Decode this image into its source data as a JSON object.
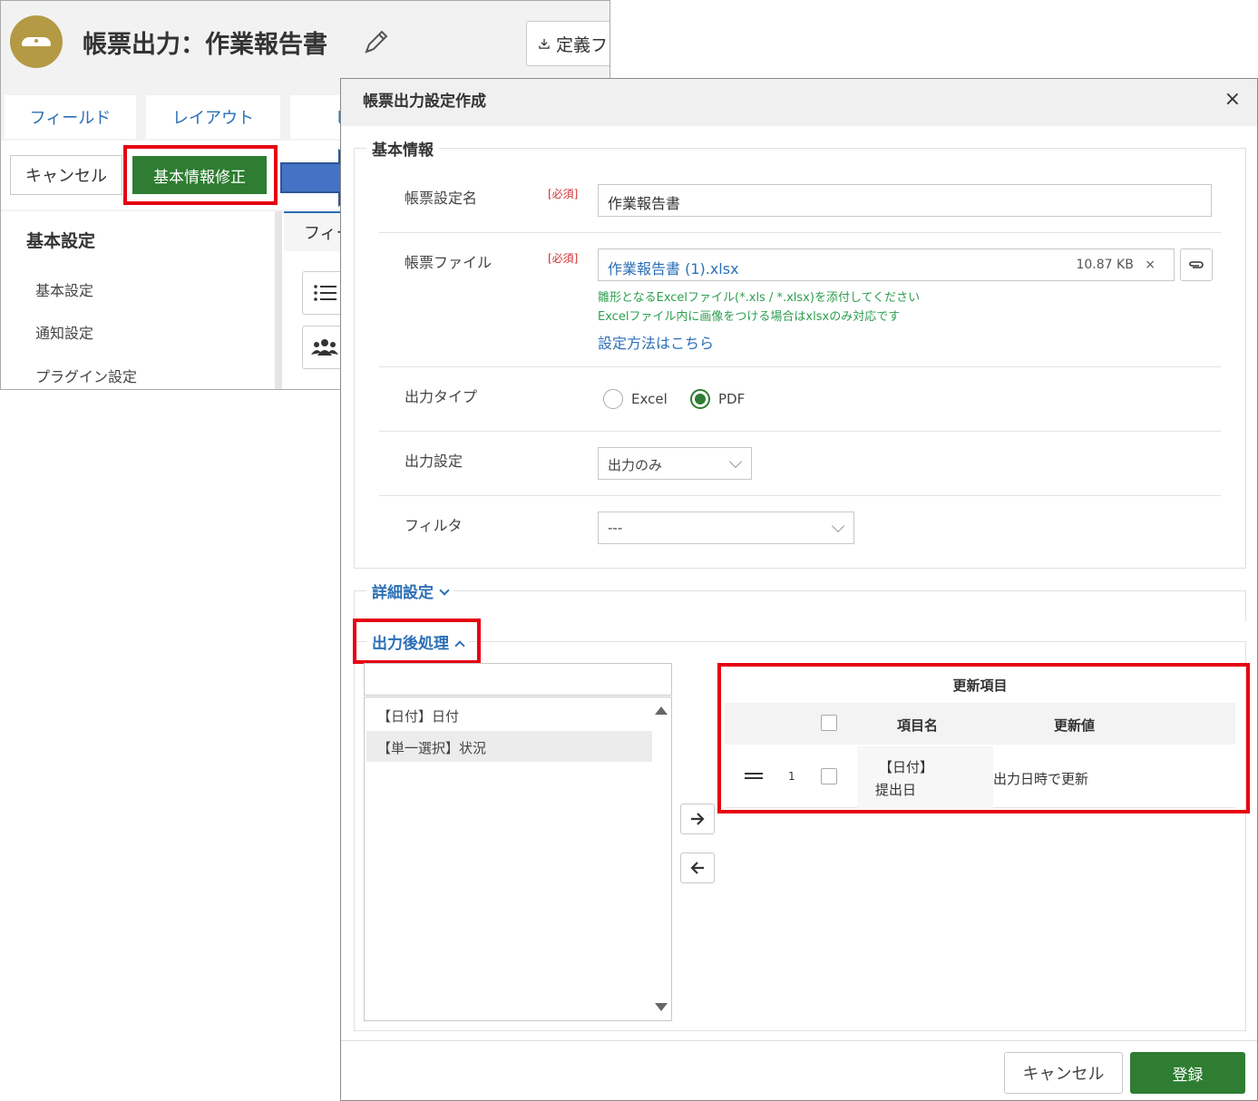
{
  "app": {
    "title": "帳票出力：作業報告書",
    "define_button": "定義ファ",
    "tabs": [
      "フィールド",
      "レイアウト",
      "ビ"
    ],
    "cancel": "キャンセル",
    "edit_basic": "基本情報修正",
    "side_menu": {
      "title": "基本設定",
      "items": [
        "基本設定",
        "通知設定",
        "プラグイン設定"
      ]
    },
    "pane_tab": "フィー"
  },
  "dialog": {
    "title": "帳票出力設定作成",
    "close": "×",
    "basic_section": "基本情報",
    "required": "[必須]",
    "fields": {
      "name_label": "帳票設定名",
      "name_value": "作業報告書",
      "file_label": "帳票ファイル",
      "file_name": "作業報告書 (1).xlsx",
      "file_size": "10.87 KB",
      "file_remove": "×",
      "hint1": "雛形となるExcelファイル(*.xls / *.xlsx)を添付してください",
      "hint2": "Excelファイル内に画像をつける場合はxlsxのみ対応です",
      "help_link": "設定方法はこちら",
      "output_type_label": "出力タイプ",
      "output_type_options": [
        "Excel",
        "PDF"
      ],
      "output_type_selected": "PDF",
      "output_setting_label": "出力設定",
      "output_setting_value": "出力のみ",
      "filter_label": "フィルタ",
      "filter_value": "---"
    },
    "detail_section": "詳細設定",
    "post_section": "出力後処理",
    "field_list": [
      "【日付】日付",
      "【単一選択】状況"
    ],
    "update_table": {
      "title": "更新項目",
      "col_field": "項目名",
      "col_value": "更新値",
      "rows": [
        {
          "no": "1",
          "field_line1": "【日付】",
          "field_line2": "提出日",
          "value": "出力日時で更新"
        }
      ]
    },
    "footer": {
      "cancel": "キャンセル",
      "submit": "登録"
    }
  },
  "colors": {
    "accent_green": "#2e7d32",
    "link_blue": "#2b6fb6",
    "highlight_red": "#e60012",
    "arrow_blue": "#4472c4"
  }
}
